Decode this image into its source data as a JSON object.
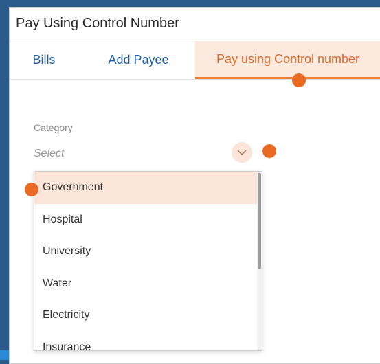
{
  "window": {
    "title": "Pay Using Control Number"
  },
  "tabs": [
    {
      "label": "Bills"
    },
    {
      "label": "Add Payee"
    },
    {
      "label": "Pay using Control number",
      "active": true
    }
  ],
  "form": {
    "category_label": "Category",
    "category_placeholder": "Select",
    "options": [
      "Government",
      "Hospital",
      "University",
      "Water",
      "Electricity",
      "Insurance"
    ],
    "highlighted_option": "Government"
  },
  "colors": {
    "accent": "#e87f3c",
    "active_tab_bg": "#fbe9dd",
    "link_blue": "#1f5fa8",
    "marker": "#ea6a22"
  },
  "icons": {
    "dropdown_toggle": "chevron-down-icon"
  }
}
